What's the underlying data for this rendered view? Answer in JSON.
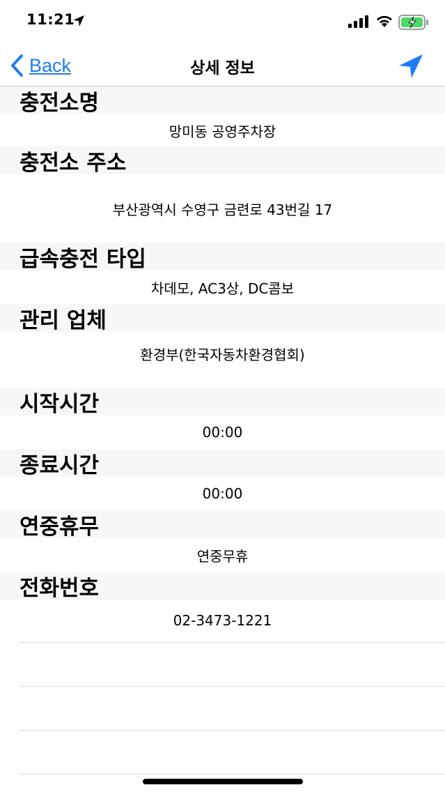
{
  "status_bar": {
    "time": "11:21",
    "icons": [
      "location-arrow-icon",
      "signal-icon",
      "wifi-icon",
      "battery-charging-icon"
    ],
    "battery_color": "#4cd964"
  },
  "nav": {
    "back_label": "Back",
    "title": "상세 정보",
    "accent_color": "#1f7cf4",
    "right_icon": "location-arrow-icon"
  },
  "sections": [
    {
      "label": "충전소명",
      "value": "망미동 공영주차장"
    },
    {
      "label": "충전소 주소",
      "value": "부산광역시 수영구 금련로 43번길 17"
    },
    {
      "label": "급속충전 타입",
      "value": "차데모, AC3상, DC콤보"
    },
    {
      "label": "관리 업체",
      "value": "환경부(한국자동차환경협회)"
    },
    {
      "label": "시작시간",
      "value": "00:00"
    },
    {
      "label": "종료시간",
      "value": "00:00"
    },
    {
      "label": "연중휴무",
      "value": "연중무휴"
    },
    {
      "label": "전화번호",
      "value": "02-3473-1221"
    }
  ]
}
